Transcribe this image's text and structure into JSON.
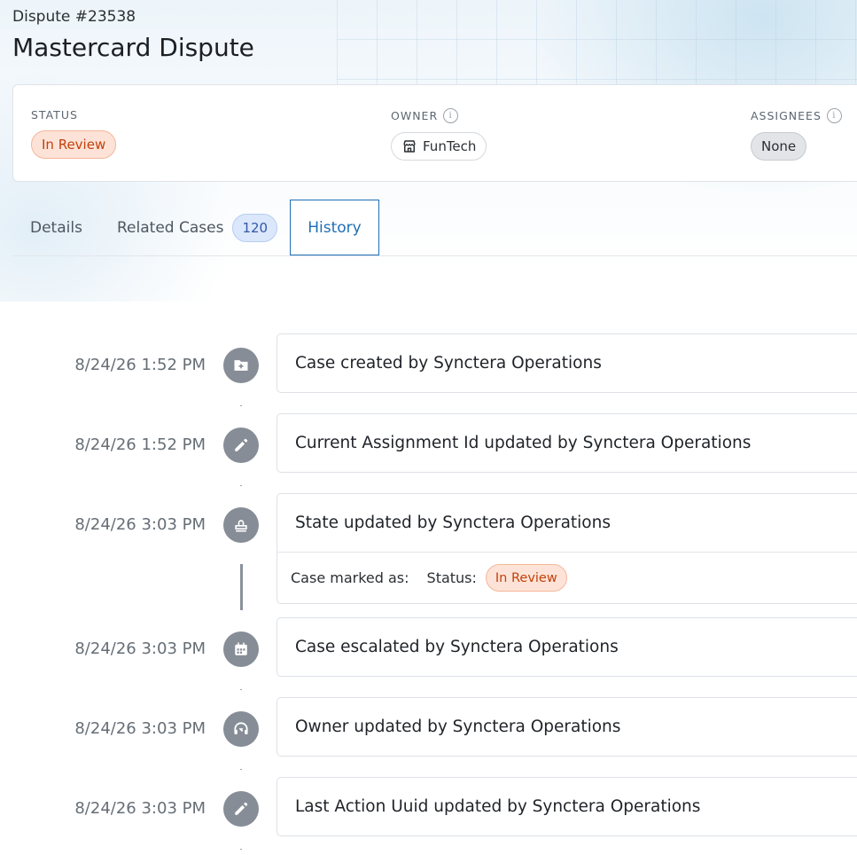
{
  "header": {
    "case_number": "Dispute #23538",
    "title": "Mastercard Dispute"
  },
  "summary": {
    "status_label": "STATUS",
    "status_value": "In Review",
    "owner_label": "OWNER",
    "owner_value": "FunTech",
    "assignees_label": "ASSIGNEES",
    "assignees_value": "None",
    "info_glyph": "i"
  },
  "tabs": [
    {
      "label": "Details"
    },
    {
      "label": "Related Cases",
      "count": "120"
    },
    {
      "label": "History",
      "active": true
    }
  ],
  "history": [
    {
      "time": "8/24/26 1:52 PM",
      "text": "Case created by Synctera Operations",
      "icon": "folder-plus-icon"
    },
    {
      "time": "8/24/26 1:52 PM",
      "text": "Current Assignment Id updated by Synctera Operations",
      "icon": "pencil-icon"
    },
    {
      "time": "8/24/26 3:03 PM",
      "text": "State updated by Synctera Operations",
      "icon": "stamp-icon",
      "detail": {
        "prefix": "Case marked as:",
        "key": "Status:",
        "value": "In Review"
      }
    },
    {
      "time": "8/24/26 3:03 PM",
      "text": "Case escalated by Synctera Operations",
      "icon": "calendar-icon"
    },
    {
      "time": "8/24/26 3:03 PM",
      "text": "Owner updated by Synctera Operations",
      "icon": "headset-icon"
    },
    {
      "time": "8/24/26 3:03 PM",
      "text": "Last Action Uuid updated by Synctera Operations",
      "icon": "pencil-icon"
    }
  ],
  "colors": {
    "accent": "#1f6fb5",
    "status_bg": "#fde3d7",
    "status_text": "#c2410c",
    "icon_circle": "#868d96"
  }
}
